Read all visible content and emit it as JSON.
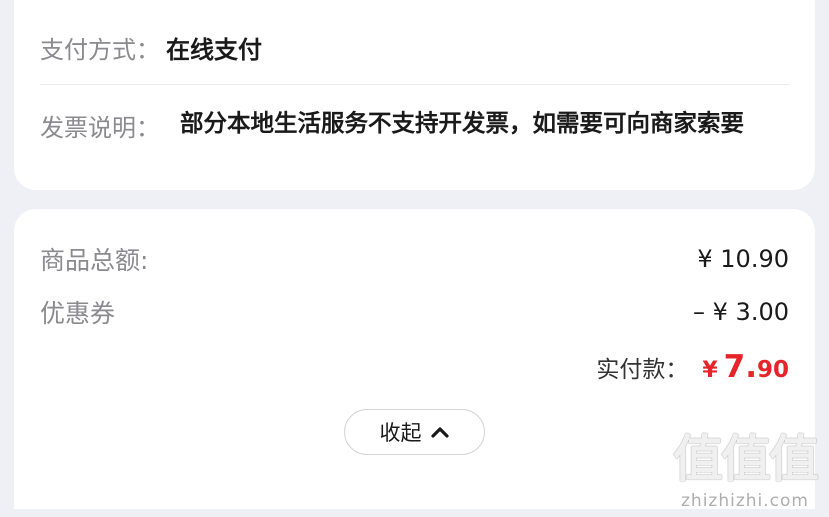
{
  "order_info": {
    "payment_label": "支付方式：",
    "payment_value": "在线支付",
    "invoice_label": "发票说明：",
    "invoice_value": "部分本地生活服务不支持开发票，如需要可向商家索要"
  },
  "amounts": {
    "subtotal_label": "商品总额:",
    "subtotal_value": "¥ 10.90",
    "coupon_label": "优惠券",
    "coupon_value": "– ¥ 3.00",
    "total_label": "实付款：",
    "total_currency": "¥",
    "total_int": "7.",
    "total_dec": "90",
    "total_color": "#e5252a"
  },
  "collapse": {
    "label": "收起",
    "icon": "chevron-up-icon"
  },
  "watermark": {
    "chars": "值值值",
    "url": "zhizhizhi.com"
  }
}
